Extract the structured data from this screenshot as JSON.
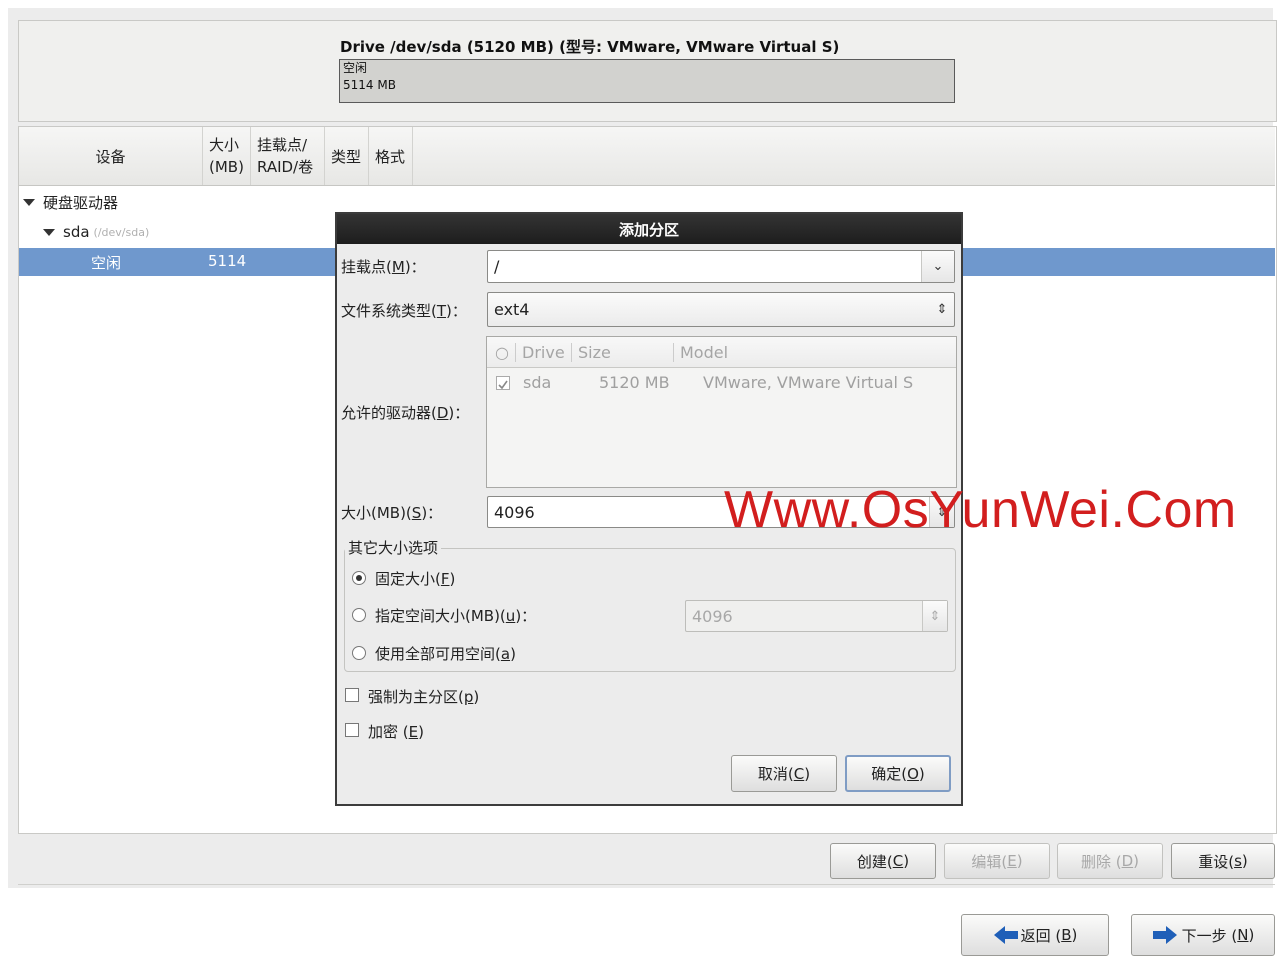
{
  "drive": {
    "title": "Drive /dev/sda (5120 MB) (型号: VMware, VMware Virtual S)",
    "segment_label": "空闲",
    "segment_size": "5114 MB"
  },
  "columns": {
    "device": "设备",
    "size_line1": "大小",
    "size_line2": "(MB)",
    "mount_line1": "挂载点/",
    "mount_line2": "RAID/卷",
    "type": "类型",
    "format": "格式"
  },
  "tree": {
    "group_label": "硬盘驱动器",
    "disk_name": "sda",
    "disk_path": "(/dev/sda)",
    "free_label": "空闲",
    "free_size": "5114"
  },
  "dialog": {
    "title": "添加分区",
    "mount_label": "挂载点(",
    "mount_key": "M",
    "mount_tail": ")：",
    "mount_value": "/",
    "fstype_label": "文件系统类型(",
    "fstype_key": "T",
    "fstype_tail": ")：",
    "fstype_value": "ext4",
    "drives_label": "允许的驱动器(",
    "drives_key": "D",
    "drives_tail": ")：",
    "drives_headers": {
      "radio": "○",
      "drive": "Drive",
      "size": "Size",
      "model": "Model"
    },
    "drives_rows": [
      {
        "checked": true,
        "drive": "sda",
        "size": "5120 MB",
        "model": "VMware, VMware Virtual S"
      }
    ],
    "size_label": "大小(MB)(",
    "size_key": "S",
    "size_tail": ")：",
    "size_value": "4096",
    "other_options_legend": "其它大小选项",
    "opt_fixed": "固定大小(",
    "opt_fixed_key": "F",
    "opt_fixed_tail": ")",
    "opt_upto": "指定空间大小(MB)(",
    "opt_upto_key": "u",
    "opt_upto_tail": ")：",
    "opt_upto_value": "4096",
    "opt_fill": "使用全部可用空间(",
    "opt_fill_key": "a",
    "opt_fill_tail": ")",
    "selected_option": "fixed",
    "force_primary": "强制为主分区(",
    "force_primary_key": "p",
    "force_primary_tail": ")",
    "encrypt": "加密 (",
    "encrypt_key": "E",
    "encrypt_tail": ")",
    "cancel_label": "取消(",
    "cancel_key": "C",
    "cancel_tail": ")",
    "ok_label": "确定(",
    "ok_key": "O",
    "ok_tail": ")"
  },
  "actions": {
    "create": "创建(",
    "create_key": "C",
    "create_tail": ")",
    "edit": "编辑(",
    "edit_key": "E",
    "edit_tail": ")",
    "delete": "删除 (",
    "delete_key": "D",
    "delete_tail": ")",
    "reset": "重设(",
    "reset_key": "s",
    "reset_tail": ")"
  },
  "nav": {
    "back": "返回 (",
    "back_key": "B",
    "back_tail": ")",
    "next": "下一步 (",
    "next_key": "N",
    "next_tail": ")"
  },
  "watermark": "Www.OsYunWei.Com",
  "colors": {
    "selection": "#6f98cd",
    "dialog_titlebar": "#1d1d1d",
    "watermark": "#d21e1e",
    "arrow_blue": "#1f5fb8"
  }
}
